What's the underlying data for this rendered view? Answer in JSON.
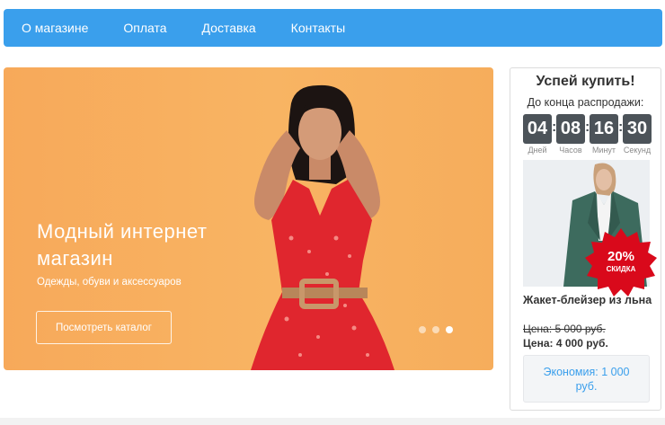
{
  "nav": {
    "items": [
      {
        "label": "О магазине"
      },
      {
        "label": "Оплата"
      },
      {
        "label": "Доставка"
      },
      {
        "label": "Контакты"
      }
    ]
  },
  "hero": {
    "title": "Модный интернет магазин",
    "subtitle": "Одежды, обуви и  аксессуаров",
    "button_label": "Посмотреть каталог",
    "slides": 3,
    "active_slide": 3
  },
  "sale": {
    "title": "Успей купить!",
    "subtitle": "До конца распродажи:",
    "timer": [
      {
        "value": "04",
        "label": "Дней"
      },
      {
        "value": "08",
        "label": "Часов"
      },
      {
        "value": "16",
        "label": "Минут"
      },
      {
        "value": "30",
        "label": "Секунд"
      }
    ],
    "badge_percent": "20%",
    "badge_text": "СКИДКА",
    "product_name": "Жакет-блейзер из льна",
    "old_price": "Цена: 5 000  руб.",
    "new_price": "Цена: 4 000  руб.",
    "economy": "Экономия: 1 000 руб."
  },
  "colors": {
    "nav_bg": "#3a9fec",
    "hero_bg": "#f7aa5b",
    "timer_bg": "#4c5359",
    "badge": "#d9091b",
    "economy_text": "#3a9fec"
  }
}
